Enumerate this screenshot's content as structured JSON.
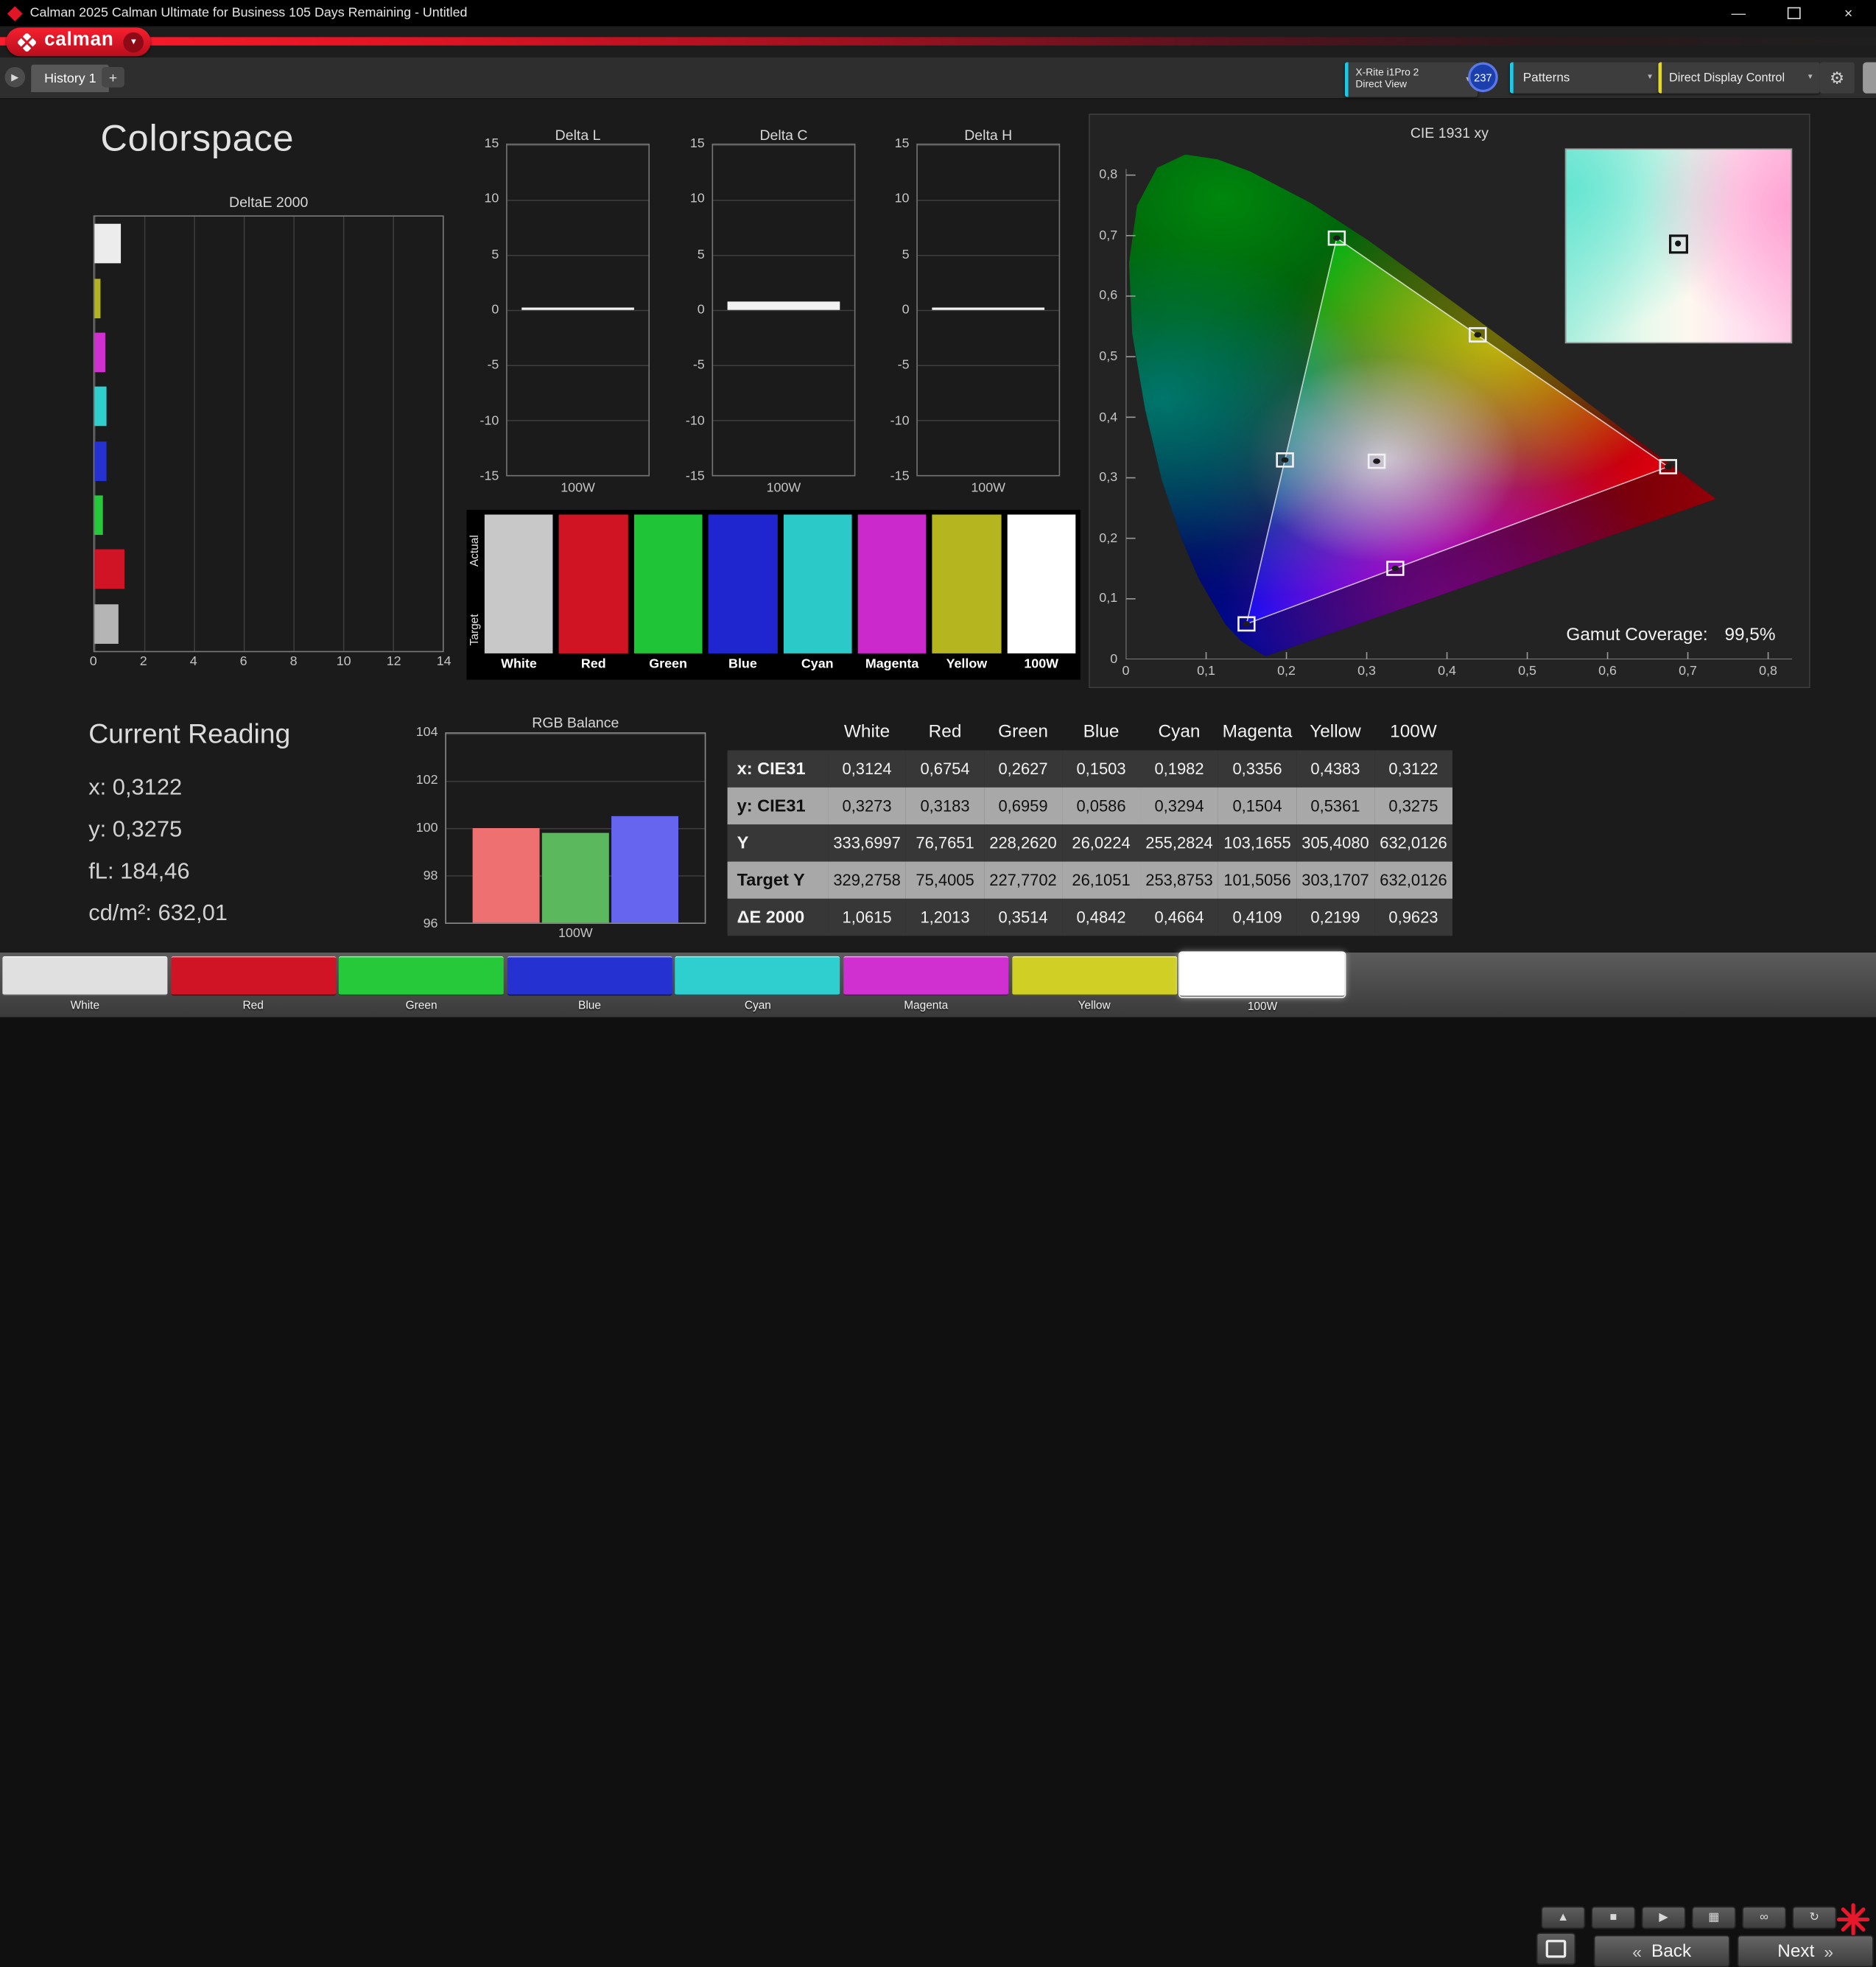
{
  "window": {
    "title": "Calman 2025 Calman Ultimate for Business 105 Days Remaining  - Untitled",
    "minimize": "—",
    "close": "×"
  },
  "brand": {
    "logo_text": "calman",
    "brand_red": "#e01525"
  },
  "toolbar": {
    "history_tab": "History 1",
    "add_tab": "+",
    "meter_line1": "X-Rite i1Pro 2",
    "meter_line2": "Direct View",
    "meter_badge": "237",
    "patterns": "Patterns",
    "display_control": "Direct Display Control"
  },
  "icons": {
    "tab_arrow": "▶",
    "dropdown": "▼",
    "gear": "⚙",
    "up": "▲",
    "stop": "■",
    "play": "▶",
    "save": "▦",
    "link": "∞",
    "refresh": "↻",
    "back_chevron": "«",
    "next_chevron": "»"
  },
  "page": {
    "title": "Colorspace"
  },
  "chart_data": [
    {
      "id": "delta_e",
      "type": "bar",
      "orientation": "horizontal",
      "title": "DeltaE 2000",
      "xlim": [
        0,
        14
      ],
      "x_ticks": [
        "0",
        "2",
        "4",
        "6",
        "8",
        "10",
        "12",
        "14"
      ],
      "categories": [
        "White",
        "Yellow",
        "Magenta",
        "Cyan",
        "Blue",
        "Green",
        "Red",
        "100W"
      ],
      "values": [
        1.0615,
        0.2199,
        0.4109,
        0.4664,
        0.4842,
        0.3514,
        1.2013,
        0.9623
      ],
      "colors": [
        "#ececec",
        "#b3b31f",
        "#cf30cf",
        "#30cfcf",
        "#2531d1",
        "#25c93a",
        "#d11425",
        "#b5b5b5"
      ]
    },
    {
      "id": "delta_l",
      "type": "bar",
      "title": "Delta L",
      "ylim": [
        -15,
        15
      ],
      "y_ticks": [
        "15",
        "10",
        "5",
        "0",
        "-5",
        "-10",
        "-15"
      ],
      "categories": [
        "100W"
      ],
      "values": [
        0.0
      ],
      "xlabel": "100W"
    },
    {
      "id": "delta_c",
      "type": "bar",
      "title": "Delta C",
      "ylim": [
        -15,
        15
      ],
      "y_ticks": [
        "15",
        "10",
        "5",
        "0",
        "-5",
        "-10",
        "-15"
      ],
      "categories": [
        "100W"
      ],
      "values": [
        0.8
      ],
      "xlabel": "100W"
    },
    {
      "id": "delta_h",
      "type": "bar",
      "title": "Delta H",
      "ylim": [
        -15,
        15
      ],
      "y_ticks": [
        "15",
        "10",
        "5",
        "0",
        "-5",
        "-10",
        "-15"
      ],
      "categories": [
        "100W"
      ],
      "values": [
        0.0
      ],
      "xlabel": "100W"
    },
    {
      "id": "rgb_balance",
      "type": "bar",
      "title": "RGB Balance",
      "ylim": [
        96,
        104
      ],
      "y_ticks": [
        "104",
        "102",
        "100",
        "98",
        "96"
      ],
      "xlabel": "100W",
      "categories": [
        "Red",
        "Green",
        "Blue"
      ],
      "values": [
        100.0,
        99.8,
        100.5
      ],
      "colors": [
        "#ef7070",
        "#5cb85c",
        "#6565f0"
      ]
    },
    {
      "id": "cie",
      "type": "scatter",
      "title": "CIE 1931 xy",
      "x_ticks": [
        "0",
        "0,1",
        "0,2",
        "0,3",
        "0,4",
        "0,5",
        "0,6",
        "0,7",
        "0,8"
      ],
      "y_ticks": [
        "0,8",
        "0,7",
        "0,6",
        "0,5",
        "0,4",
        "0,3",
        "0,2",
        "0,1",
        "0"
      ],
      "points": [
        {
          "name": "white",
          "x": 0.3124,
          "y": 0.3273
        },
        {
          "name": "red",
          "x": 0.6754,
          "y": 0.3183
        },
        {
          "name": "green",
          "x": 0.2627,
          "y": 0.6959
        },
        {
          "name": "blue",
          "x": 0.1503,
          "y": 0.0586
        },
        {
          "name": "cyan",
          "x": 0.1982,
          "y": 0.3294
        },
        {
          "name": "magenta",
          "x": 0.3356,
          "y": 0.1504
        },
        {
          "name": "yellow",
          "x": 0.4383,
          "y": 0.5361
        }
      ],
      "triangle": {
        "red": [
          0.6754,
          0.3183
        ],
        "green": [
          0.2627,
          0.6959
        ],
        "blue": [
          0.1503,
          0.0586
        ]
      },
      "gamut_coverage_label": "Gamut Coverage:",
      "gamut_coverage_value": "99,5%"
    }
  ],
  "swatch_strip": {
    "row_labels": [
      "Actual",
      "Target"
    ],
    "columns": [
      {
        "label": "White",
        "color": "#c8c8c8"
      },
      {
        "label": "Red",
        "color": "#d01424"
      },
      {
        "label": "Green",
        "color": "#1fc437"
      },
      {
        "label": "Blue",
        "color": "#2026cf"
      },
      {
        "label": "Cyan",
        "color": "#2cc9c9"
      },
      {
        "label": "Magenta",
        "color": "#cc29cc"
      },
      {
        "label": "Yellow",
        "color": "#b5b51f"
      },
      {
        "label": "100W",
        "color": "#ffffff"
      }
    ]
  },
  "current_reading": {
    "title": "Current Reading",
    "lines": [
      "x: 0,3122",
      "y: 0,3275",
      "fL: 184,46",
      "cd/m²: 632,01"
    ]
  },
  "table": {
    "headers": [
      "",
      "White",
      "Red",
      "Green",
      "Blue",
      "Cyan",
      "Magenta",
      "Yellow",
      "100W"
    ],
    "rows": [
      {
        "label": "x: CIE31",
        "tone": "dark",
        "values": [
          "0,3124",
          "0,6754",
          "0,2627",
          "0,1503",
          "0,1982",
          "0,3356",
          "0,4383",
          "0,3122"
        ]
      },
      {
        "label": "y: CIE31",
        "tone": "light",
        "values": [
          "0,3273",
          "0,3183",
          "0,6959",
          "0,0586",
          "0,3294",
          "0,1504",
          "0,5361",
          "0,3275"
        ]
      },
      {
        "label": "Y",
        "tone": "dark",
        "values": [
          "333,6997",
          "76,7651",
          "228,2620",
          "26,0224",
          "255,2824",
          "103,1655",
          "305,4080",
          "632,0126"
        ]
      },
      {
        "label": "Target Y",
        "tone": "light",
        "values": [
          "329,2758",
          "75,4005",
          "227,7702",
          "26,1051",
          "253,8753",
          "101,5056",
          "303,1707",
          "632,0126"
        ]
      },
      {
        "label": "ΔE 2000",
        "tone": "dark",
        "values": [
          "1,0615",
          "1,2013",
          "0,3514",
          "0,4842",
          "0,4664",
          "0,4109",
          "0,2199",
          "0,9623"
        ]
      }
    ]
  },
  "bottom_bar": {
    "swatches": [
      {
        "label": "White",
        "color": "#e0e0e0"
      },
      {
        "label": "Red",
        "color": "#d11425"
      },
      {
        "label": "Green",
        "color": "#25c93a"
      },
      {
        "label": "Blue",
        "color": "#2531d1"
      },
      {
        "label": "Cyan",
        "color": "#30cfcf"
      },
      {
        "label": "Magenta",
        "color": "#cf30cf"
      },
      {
        "label": "Yellow",
        "color": "#cfcf25"
      },
      {
        "label": "100W",
        "color": "#ffffff",
        "selected": true
      }
    ],
    "icon_buttons": [
      {
        "name": "up",
        "glyph": "▲"
      },
      {
        "name": "stop",
        "glyph": "■"
      },
      {
        "name": "play",
        "glyph": "▶"
      },
      {
        "name": "save",
        "glyph": "▦"
      },
      {
        "name": "link",
        "glyph": "∞"
      },
      {
        "name": "refresh",
        "glyph": "↻"
      }
    ],
    "back_label": "Back",
    "next_label": "Next"
  }
}
